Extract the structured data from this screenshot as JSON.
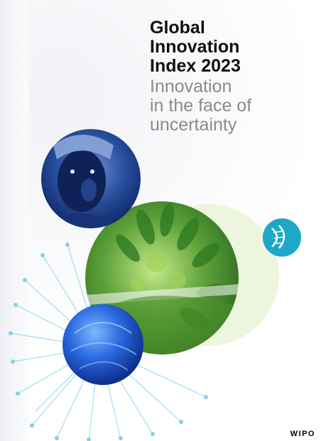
{
  "cover": {
    "title_lines": [
      "Global",
      "Innovation",
      "Index 2023"
    ],
    "subtitle_lines": [
      "Innovation",
      "in the face of",
      "uncertainty"
    ],
    "publisher_logo": "WIPO"
  },
  "colors": {
    "title": "#111111",
    "subtitle": "#8a8a8a",
    "teal_circle": "#1ea8c8",
    "blue_sphere": "#1f5fd6",
    "green": "#3e8a2a",
    "pale_circle": "#eef5de"
  },
  "icons": {
    "portrait": "portrait-photo",
    "dna": "dna-icon",
    "plant": "plant-closeup",
    "sphere": "blue-sphere",
    "burst": "neuron-burst"
  }
}
